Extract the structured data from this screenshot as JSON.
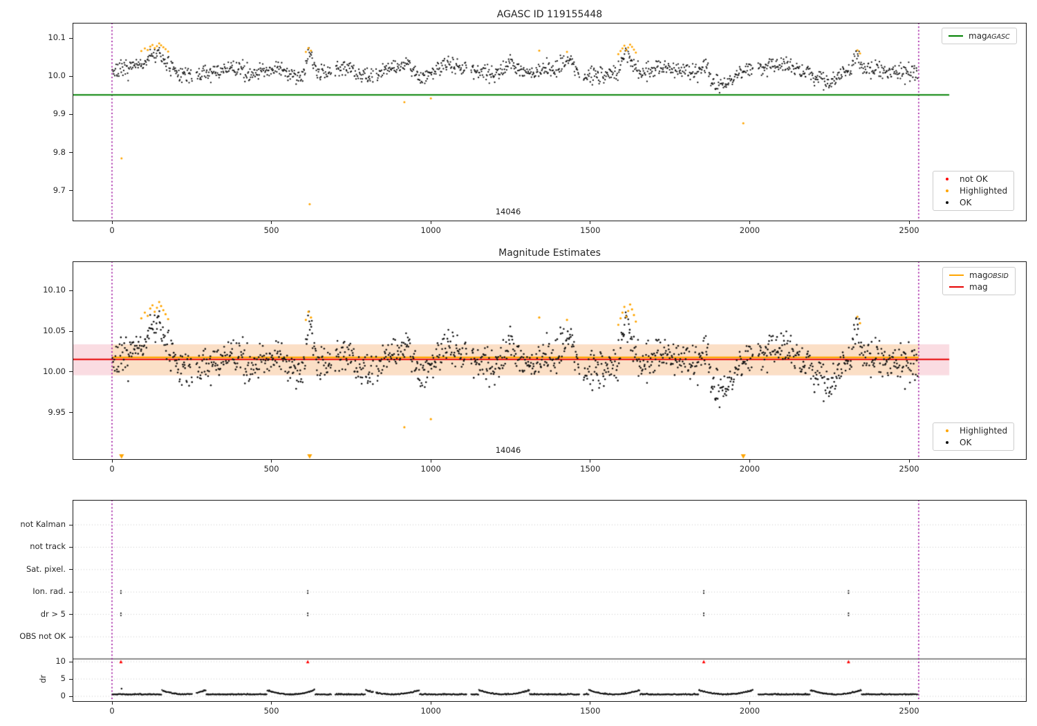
{
  "colors": {
    "ok": "#111111",
    "not_ok": "#ff0000",
    "highlight": "#ffa500",
    "agasc_line": "#008000",
    "mag_line": "#e60000",
    "obsid_line": "#ffa500",
    "band_obsid": "#fbdfc6",
    "band_mag": "#fadce2",
    "vline": "#990099",
    "grid": "#c9c9c9",
    "spine": "#1a1a1a"
  },
  "top": {
    "title": "AGASC ID 119155448",
    "annotation": "14046",
    "legend_line": {
      "main": "mag",
      "sub": "AGASC"
    },
    "legend_markers": [
      {
        "label": "not OK",
        "color_key": "not_ok"
      },
      {
        "label": "Highlighted",
        "color_key": "highlight"
      },
      {
        "label": "OK",
        "color_key": "ok"
      }
    ]
  },
  "middle": {
    "title": "Magnitude Estimates",
    "annotation": "14046",
    "legend_lines": [
      {
        "main": "mag",
        "sub": "OBSID",
        "color_key": "obsid_line"
      },
      {
        "main": "mag",
        "sub": "",
        "color_key": "mag_line"
      }
    ],
    "legend_markers": [
      {
        "label": "Highlighted",
        "color_key": "highlight"
      },
      {
        "label": "OK",
        "color_key": "ok"
      }
    ]
  },
  "bottom": {
    "ylabel": "dr"
  },
  "chart_data": [
    {
      "type": "scatter",
      "title": "AGASC ID 119155448",
      "xlim": [
        -124,
        2873
      ],
      "ylim": [
        9.62,
        10.14
      ],
      "xtick_vals": [
        0,
        500,
        1000,
        1500,
        2000,
        2500
      ],
      "xtick_labels": [
        "0",
        "500",
        "1000",
        "1500",
        "2000",
        "2500"
      ],
      "ytick_vals": [
        10.1,
        10.0,
        9.9,
        9.8,
        9.7
      ],
      "ytick_labels": [
        "10.1",
        "10.0",
        "9.9",
        "9.8",
        "9.7"
      ],
      "hline": {
        "label": "mag_AGASC",
        "y": 9.951,
        "x_span": [
          -124,
          2626
        ]
      },
      "vlines": [
        0,
        2530
      ],
      "annotation": {
        "text": "14046",
        "x": 1245
      },
      "legend_position": "upper right / lower right",
      "grid": false
    },
    {
      "type": "scatter",
      "title": "Magnitude Estimates",
      "xlim": [
        -124,
        2873
      ],
      "ylim": [
        9.892,
        10.136
      ],
      "xtick_vals": [
        0,
        500,
        1000,
        1500,
        2000,
        2500
      ],
      "xtick_labels": [
        "0",
        "500",
        "1000",
        "1500",
        "2000",
        "2500"
      ],
      "ytick_vals": [
        10.1,
        10.05,
        10.0,
        9.95
      ],
      "ytick_labels": [
        "10.10",
        "10.05",
        "10.00",
        "9.95"
      ],
      "mag_line": {
        "label": "mag",
        "y": 10.0155,
        "x_span": [
          -124,
          2626
        ]
      },
      "obsid_line": {
        "label": "mag_OBSID",
        "y": 10.018,
        "x_span": [
          0,
          2530
        ]
      },
      "band_mag": {
        "lo": 9.996,
        "hi": 10.034,
        "x_span": [
          -124,
          2626
        ]
      },
      "band_obsid": {
        "lo": 9.996,
        "hi": 10.034,
        "x_span": [
          0,
          2530
        ]
      },
      "vlines": [
        0,
        2530
      ],
      "annotation": {
        "text": "14046",
        "x": 1245
      },
      "clipped_low_markers_x": [
        30,
        620,
        1980
      ],
      "grid": false
    },
    {
      "type": "flags",
      "rows": [
        "not Kalman",
        "not track",
        "Sat. pixel.",
        "Ion. rad.",
        "dr > 5",
        "OBS not OK"
      ],
      "dr_tick_vals": [
        10,
        5,
        0
      ],
      "dr_tick_labels": [
        "10",
        "5",
        "0"
      ],
      "ylabel": "dr",
      "xtick_vals": [
        0,
        500,
        1000,
        1500,
        2000,
        2500
      ],
      "xtick_labels": [
        "0",
        "500",
        "1000",
        "1500",
        "2000",
        "2500"
      ],
      "flag_points": {
        "Ion. rad.": [
          28,
          614,
          1856,
          2310
        ],
        "dr > 5": [
          28,
          614,
          1856,
          2310
        ]
      },
      "dr_clipped_red_x": [
        28,
        614,
        1856,
        2310
      ],
      "dr_outliers": [
        [
          30,
          2.2
        ]
      ],
      "separator_hline_dr": 10.8,
      "vlines": [
        0,
        2530
      ],
      "grid": "dotted horizontal at each row and dr tick"
    }
  ],
  "scatter_model": {
    "n": 1400,
    "x_start": 2,
    "x_end": 2528,
    "seed": 7,
    "base": 10.012,
    "wave_amp": 0.009,
    "wave_period": 330,
    "noise_sigma": 0.011,
    "bumps": [
      [
        140,
        40,
        0.042
      ],
      [
        520,
        20,
        0.018
      ],
      [
        620,
        16,
        0.05
      ],
      [
        880,
        35,
        0.02
      ],
      [
        925,
        18,
        0.03
      ],
      [
        1060,
        25,
        0.016
      ],
      [
        1245,
        30,
        0.03
      ],
      [
        1430,
        22,
        0.022
      ],
      [
        1612,
        22,
        0.052
      ],
      [
        1860,
        15,
        0.028
      ],
      [
        2120,
        45,
        0.016
      ],
      [
        2335,
        12,
        0.045
      ],
      [
        440,
        25,
        -0.012
      ],
      [
        790,
        35,
        -0.02
      ],
      [
        980,
        25,
        -0.016
      ],
      [
        1490,
        18,
        -0.014
      ],
      [
        1910,
        40,
        -0.026
      ],
      [
        2250,
        30,
        -0.02
      ],
      [
        2430,
        20,
        -0.012
      ]
    ],
    "gaps": [
      [
        252,
        264
      ],
      [
        688,
        700
      ],
      [
        820,
        828
      ],
      [
        1112,
        1124
      ],
      [
        1466,
        1478
      ],
      [
        2012,
        2026
      ]
    ]
  },
  "highlighted_points": [
    [
      92,
      10.066
    ],
    [
      103,
      10.073
    ],
    [
      112,
      10.069
    ],
    [
      120,
      10.078
    ],
    [
      127,
      10.082
    ],
    [
      134,
      10.074
    ],
    [
      141,
      10.079
    ],
    [
      148,
      10.086
    ],
    [
      154,
      10.081
    ],
    [
      161,
      10.076
    ],
    [
      168,
      10.071
    ],
    [
      176,
      10.065
    ],
    [
      608,
      10.064
    ],
    [
      616,
      10.074
    ],
    [
      624,
      10.067
    ],
    [
      917,
      9.932
    ],
    [
      1000,
      9.942
    ],
    [
      1340,
      10.067
    ],
    [
      1427,
      10.064
    ],
    [
      1588,
      10.058
    ],
    [
      1595,
      10.066
    ],
    [
      1601,
      10.073
    ],
    [
      1607,
      10.08
    ],
    [
      1613,
      10.068
    ],
    [
      1619,
      10.075
    ],
    [
      1625,
      10.083
    ],
    [
      1631,
      10.077
    ],
    [
      1637,
      10.07
    ],
    [
      1643,
      10.062
    ],
    [
      2338,
      10.068
    ],
    [
      2346,
      10.06
    ],
    [
      30,
      9.785
    ],
    [
      620,
      9.665
    ],
    [
      1980,
      9.877
    ]
  ],
  "dr_model": {
    "base": 0.45,
    "noise_sigma": 0.13,
    "smile_amp": 1.25,
    "smiles": [
      [
        225,
        70
      ],
      [
        560,
        75
      ],
      [
        880,
        85
      ],
      [
        1230,
        80
      ],
      [
        1575,
        80
      ],
      [
        1925,
        85
      ],
      [
        2270,
        80
      ]
    ]
  }
}
